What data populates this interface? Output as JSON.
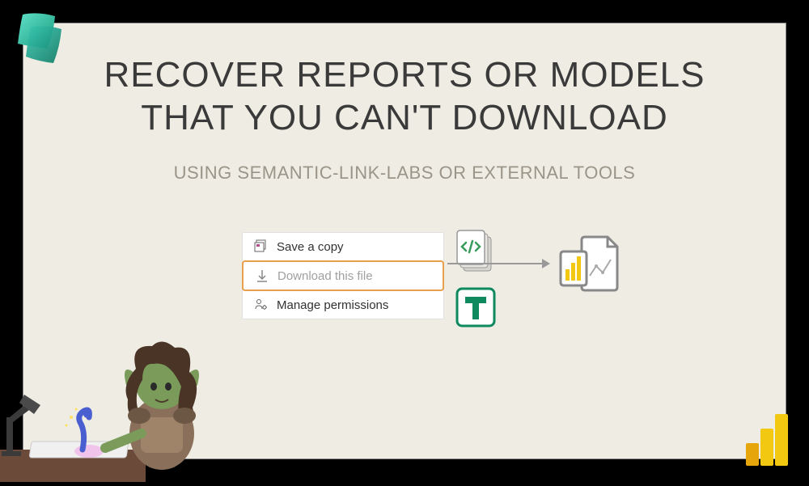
{
  "title_line1": "RECOVER REPORTS OR MODELS",
  "title_line2": "THAT YOU CAN'T DOWNLOAD",
  "subtitle": "USING SEMANTIC-LINK-LABS OR EXTERNAL TOOLS",
  "menu": {
    "save_copy": "Save a copy",
    "download": "Download this file",
    "permissions": "Manage permissions"
  },
  "colors": {
    "highlight_border": "#e8a04c",
    "fabric_teal": "#3bc8b4",
    "powerbi_yellow": "#f2c811"
  }
}
